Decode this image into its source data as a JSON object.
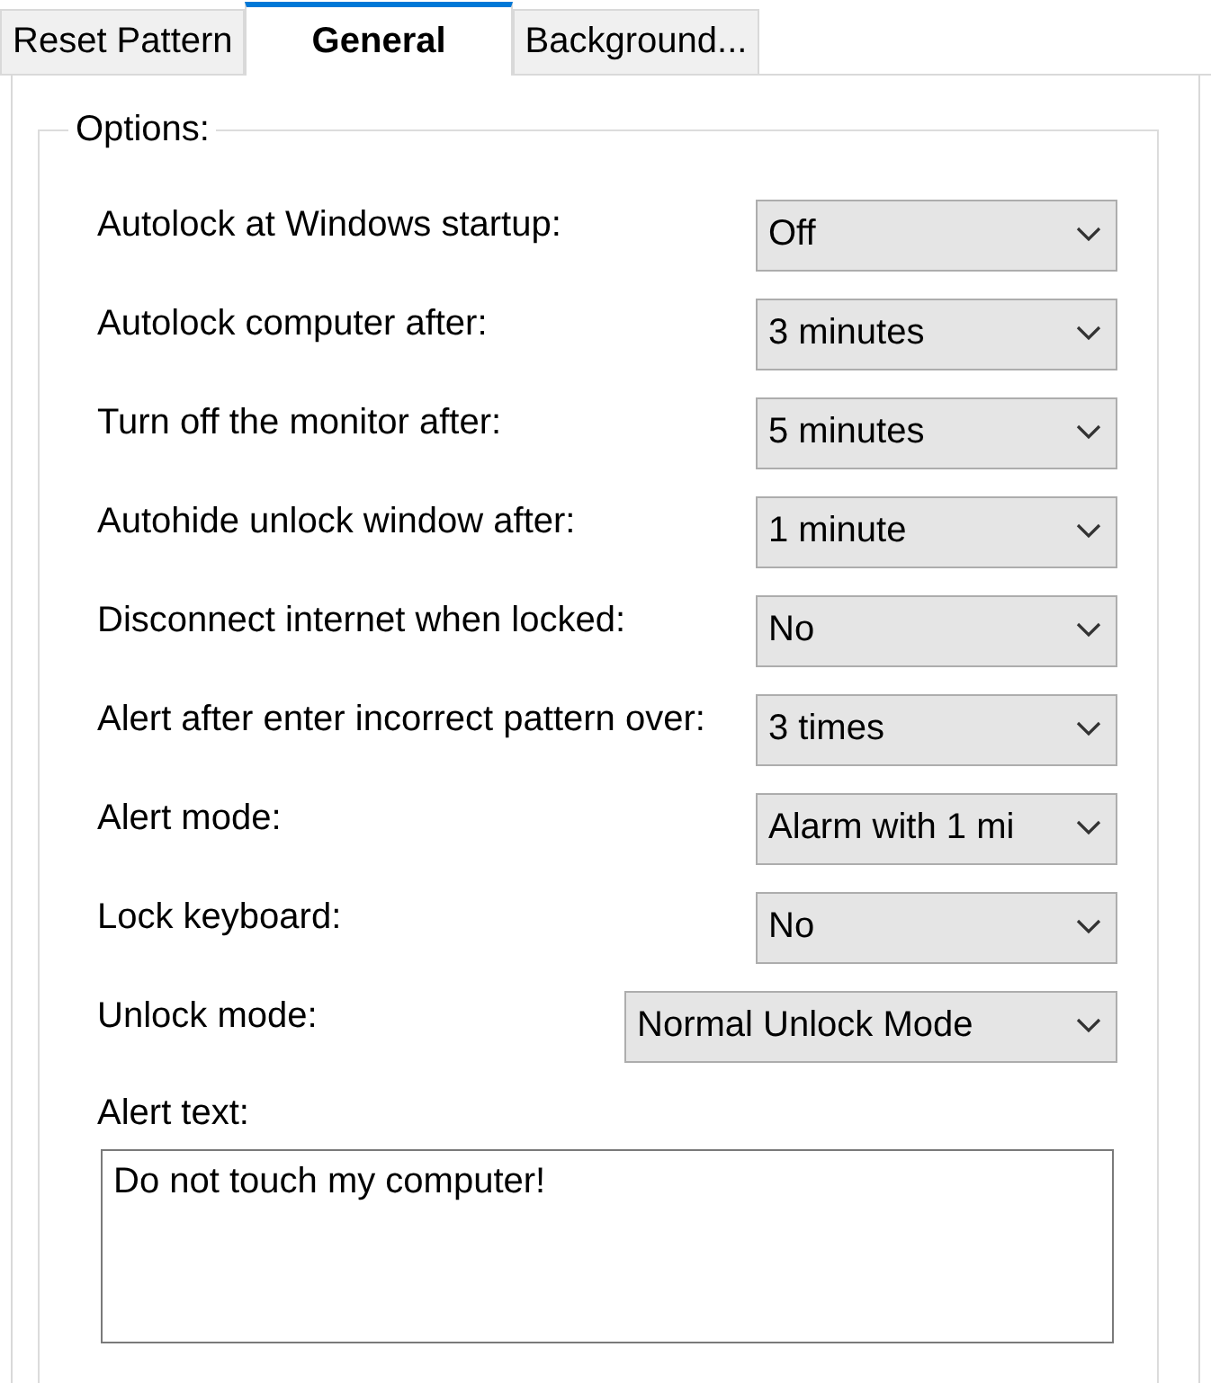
{
  "tabs": [
    {
      "label": "Reset Pattern",
      "selected": false
    },
    {
      "label": "General",
      "selected": true
    },
    {
      "label": "Background...",
      "selected": false
    }
  ],
  "options": {
    "title": "Options:",
    "settings": [
      {
        "kind": "normal",
        "label": "Autolock at Windows startup:",
        "value": "Off"
      },
      {
        "kind": "normal",
        "label": "Autolock computer after:",
        "value": "3 minutes"
      },
      {
        "kind": "normal",
        "label": "Turn off the monitor after:",
        "value": "5 minutes"
      },
      {
        "kind": "normal",
        "label": "Autohide unlock window after:",
        "value": "1 minute"
      },
      {
        "kind": "normal",
        "label": "Disconnect internet when locked:",
        "value": "No"
      },
      {
        "kind": "normal",
        "label": "Alert after enter incorrect pattern over:",
        "value": "3 times"
      },
      {
        "kind": "normal",
        "label": "Alert mode:",
        "value": "Alarm with 1 mi"
      },
      {
        "kind": "normal",
        "label": "Lock keyboard:",
        "value": "No"
      },
      {
        "kind": "wide",
        "label": "Unlock mode:",
        "value": "Normal Unlock Mode"
      }
    ],
    "alert_text": {
      "label": "Alert text:",
      "value": "Do not touch my computer!"
    }
  }
}
